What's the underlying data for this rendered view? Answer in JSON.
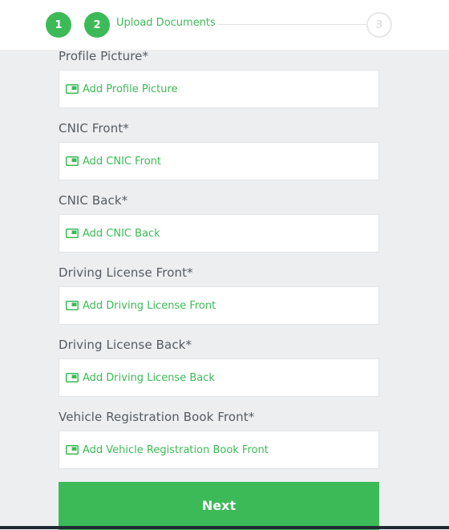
{
  "colors": {
    "accent": "#3DBA58",
    "background": "#ECEEF0",
    "label_text": "#555B61"
  },
  "stepper": {
    "step1": {
      "number": "1",
      "status": "completed"
    },
    "step2": {
      "number": "2",
      "label": "Upload Documents",
      "status": "active"
    },
    "step3": {
      "number": "3",
      "status": "upcoming"
    }
  },
  "fields": [
    {
      "label": "Profile Picture*",
      "action": "Add Profile Picture",
      "icon": "image-icon"
    },
    {
      "label": "CNIC Front*",
      "action": "Add CNIC Front",
      "icon": "image-icon"
    },
    {
      "label": "CNIC Back*",
      "action": "Add CNIC Back",
      "icon": "image-icon"
    },
    {
      "label": "Driving License Front*",
      "action": "Add Driving License Front",
      "icon": "image-icon"
    },
    {
      "label": "Driving License Back*",
      "action": "Add Driving License Back",
      "icon": "image-icon"
    },
    {
      "label": "Vehicle Registration Book Front*",
      "action": "Add Vehicle Registration Book Front",
      "icon": "image-icon"
    }
  ],
  "next_button": {
    "label": "Next"
  }
}
